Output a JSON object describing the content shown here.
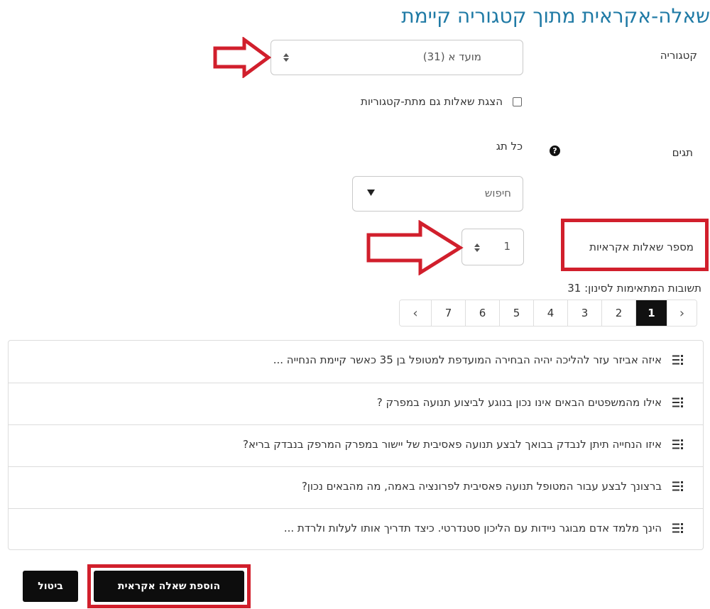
{
  "page_title": "שאלה-אקראית מתוך קטגוריה קיימת",
  "category": {
    "label": "קטגוריה",
    "selected_value": "מועד א (31)"
  },
  "subcategories_checkbox": {
    "label": "הצגת שאלות גם מתת-קטגוריות",
    "checked": false
  },
  "tags": {
    "label": "תגים",
    "value": "כל תג",
    "search_placeholder": "חיפוש"
  },
  "random_count": {
    "label": "מספר שאלות אקראיות",
    "value": "1"
  },
  "matching": {
    "text": "תשובות המתאימות לסינון: 31"
  },
  "pagination": {
    "prev": "‹",
    "next": "›",
    "pages": [
      "7",
      "6",
      "5",
      "4",
      "3",
      "2",
      "1"
    ],
    "active_page": "1"
  },
  "questions": [
    "איזה אביזר עזר להליכה יהיה הבחירה המועדפת למטופל בן 35 כאשר קיימת הנחייה ...",
    "אילו מהמשפטים הבאים אינו נכון בנוגע לביצוע תנועה במפרק ?",
    "איזו הנחייה תיתן לנבדק בבואך לבצע תנועה פאסיבית של יישור במפרק המרפק בנבדק בריא?",
    "ברצונך לבצע עבור המטופל תנועה פאסיבית לפרונציה באמה, מה מהבאים נכון?",
    "הינך מלמד אדם מבוגר ניידות עם הליכון סטנדרטי. כיצד תדריך אותו לעלות ולרדת ..."
  ],
  "buttons": {
    "add_random": "הוספת שאלה אקראית",
    "cancel": "ביטול"
  },
  "colors": {
    "title": "#1f7aa5",
    "annotation_red": "#d11f2c",
    "active_page": "#111111",
    "button_bg": "#0d0d0d"
  }
}
